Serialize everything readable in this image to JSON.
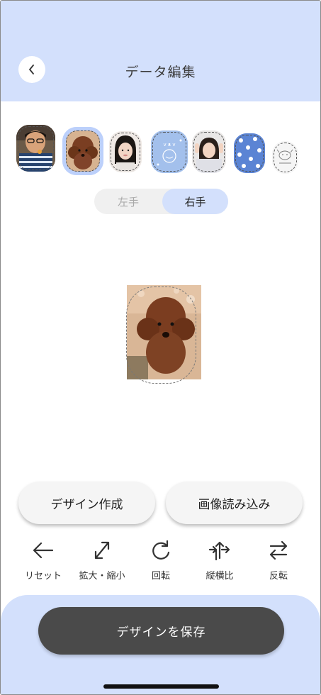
{
  "header": {
    "title": "データ編集",
    "back_icon": "chevron-left-icon",
    "background": "#d3e0fc"
  },
  "thumbnails": [
    {
      "name": "thumb-photo-boy",
      "kind": "photo"
    },
    {
      "name": "thumb-photo-poodle",
      "kind": "photo",
      "selected": true
    },
    {
      "name": "thumb-photo-girl-1",
      "kind": "photo"
    },
    {
      "name": "thumb-blue-illustration",
      "kind": "pattern"
    },
    {
      "name": "thumb-photo-girl-2",
      "kind": "photo"
    },
    {
      "name": "thumb-blue-pattern",
      "kind": "pattern"
    },
    {
      "name": "thumb-cow-sketch",
      "kind": "pattern"
    }
  ],
  "hand_toggle": {
    "left_label": "左手",
    "right_label": "右手",
    "selected": "右手"
  },
  "actions": {
    "design_label": "デザイン作成",
    "import_label": "画像読み込み"
  },
  "tools": {
    "reset_label": "リセット",
    "scale_label": "拡大・縮小",
    "rotate_label": "回転",
    "aspect_label": "縦横比",
    "flip_label": "反転"
  },
  "footer": {
    "save_label": "デザインを保存",
    "accent": "#d3e0fc",
    "button_color": "#4a4a4a"
  }
}
